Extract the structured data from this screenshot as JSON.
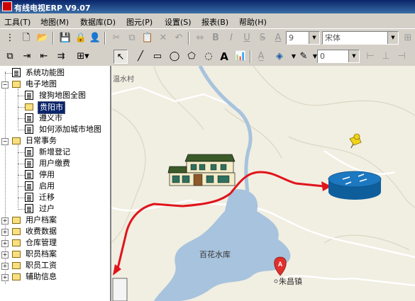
{
  "window": {
    "title": "有线电视ERP V9.07"
  },
  "menu": [
    "工具(T)",
    "地图(M)",
    "数据库(D)",
    "图元(P)",
    "设置(S)",
    "报表(B)",
    "帮助(H)"
  ],
  "toolbar": {
    "font_size": "9",
    "font_name": "宋体",
    "line_width": "0",
    "bold": "B",
    "italic": "I",
    "underline": "U",
    "strikethrough": "S",
    "text_tool": "A"
  },
  "sidebar": {
    "tree": [
      {
        "label": "系统功能图",
        "level": 0,
        "icon": "doc"
      },
      {
        "label": "电子地图",
        "level": 0,
        "icon": "folder",
        "expanded": true
      },
      {
        "label": "搜狗地图全图",
        "level": 1,
        "icon": "doc"
      },
      {
        "label": "贵阳市",
        "level": 1,
        "icon": "folder-open",
        "selected": true
      },
      {
        "label": "遵义市",
        "level": 1,
        "icon": "doc"
      },
      {
        "label": "如何添加城市地图",
        "level": 1,
        "icon": "doc"
      },
      {
        "label": "日常事务",
        "level": 0,
        "icon": "folder",
        "expanded": true
      },
      {
        "label": "新增登记",
        "level": 1,
        "icon": "doc"
      },
      {
        "label": "用户缴费",
        "level": 1,
        "icon": "doc"
      },
      {
        "label": "停用",
        "level": 1,
        "icon": "doc"
      },
      {
        "label": "启用",
        "level": 1,
        "icon": "doc"
      },
      {
        "label": "迁移",
        "level": 1,
        "icon": "doc"
      },
      {
        "label": "过户",
        "level": 1,
        "icon": "doc"
      },
      {
        "label": "用户档案",
        "level": 0,
        "icon": "folder",
        "expanded": false
      },
      {
        "label": "收费数据",
        "level": 0,
        "icon": "folder",
        "expanded": false
      },
      {
        "label": "仓库管理",
        "level": 0,
        "icon": "folder",
        "expanded": false
      },
      {
        "label": "职员档案",
        "level": 0,
        "icon": "folder",
        "expanded": false
      },
      {
        "label": "职员工资",
        "level": 0,
        "icon": "folder",
        "expanded": false
      },
      {
        "label": "辅助信息",
        "level": 0,
        "icon": "folder",
        "expanded": false
      }
    ]
  },
  "map": {
    "labels": {
      "village": "温水村",
      "lake": "百花水库",
      "town": "朱昌镇",
      "marker": "A"
    },
    "colors": {
      "land": "#f1eee2",
      "water": "#a7c3dd",
      "road": "#ffffff",
      "route": "#e0141b",
      "router": "#1c78c0"
    }
  }
}
